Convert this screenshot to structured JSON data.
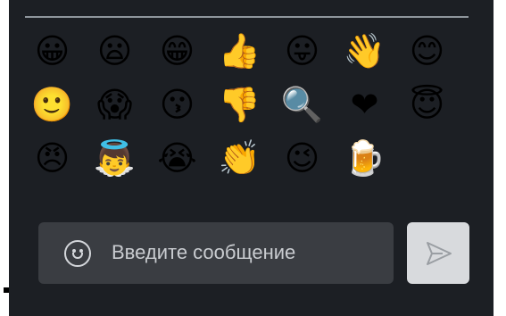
{
  "emoji_picker": {
    "emojis": [
      {
        "name": "grinning-face",
        "char": "😀"
      },
      {
        "name": "frowning-face",
        "char": "😦"
      },
      {
        "name": "grinning-squinting-face",
        "char": "😁"
      },
      {
        "name": "thumbs-up",
        "char": "👍"
      },
      {
        "name": "face-with-tongue",
        "char": "😛"
      },
      {
        "name": "waving-hand",
        "char": "👋"
      },
      {
        "name": "smiling-face-with-smiling-eyes",
        "char": "😊"
      },
      {
        "name": "slightly-smiling-face",
        "char": "🙂"
      },
      {
        "name": "face-screaming-in-fear",
        "char": "😱"
      },
      {
        "name": "kissing-face",
        "char": "😗"
      },
      {
        "name": "thumbs-down",
        "char": "👎"
      },
      {
        "name": "magnifying-glass",
        "char": "🔍"
      },
      {
        "name": "red-heart",
        "char": "❤"
      },
      {
        "name": "smiling-face-with-halo",
        "char": "😇"
      },
      {
        "name": "angry-face",
        "char": "😠"
      },
      {
        "name": "baby-angel",
        "char": "👼"
      },
      {
        "name": "loudly-crying-face",
        "char": "😭"
      },
      {
        "name": "clapping-hands",
        "char": "👏"
      },
      {
        "name": "winking-face",
        "char": "😉"
      },
      {
        "name": "beer-mug",
        "char": "🍺"
      }
    ]
  },
  "composer": {
    "placeholder": "Введите сообщение",
    "emoji_button_icon": "smiley-icon",
    "send_button_icon": "send-icon"
  },
  "colors": {
    "panel_bg": "#1c1f24",
    "input_bg": "#3a3d42",
    "send_bg": "#d8dadd"
  }
}
